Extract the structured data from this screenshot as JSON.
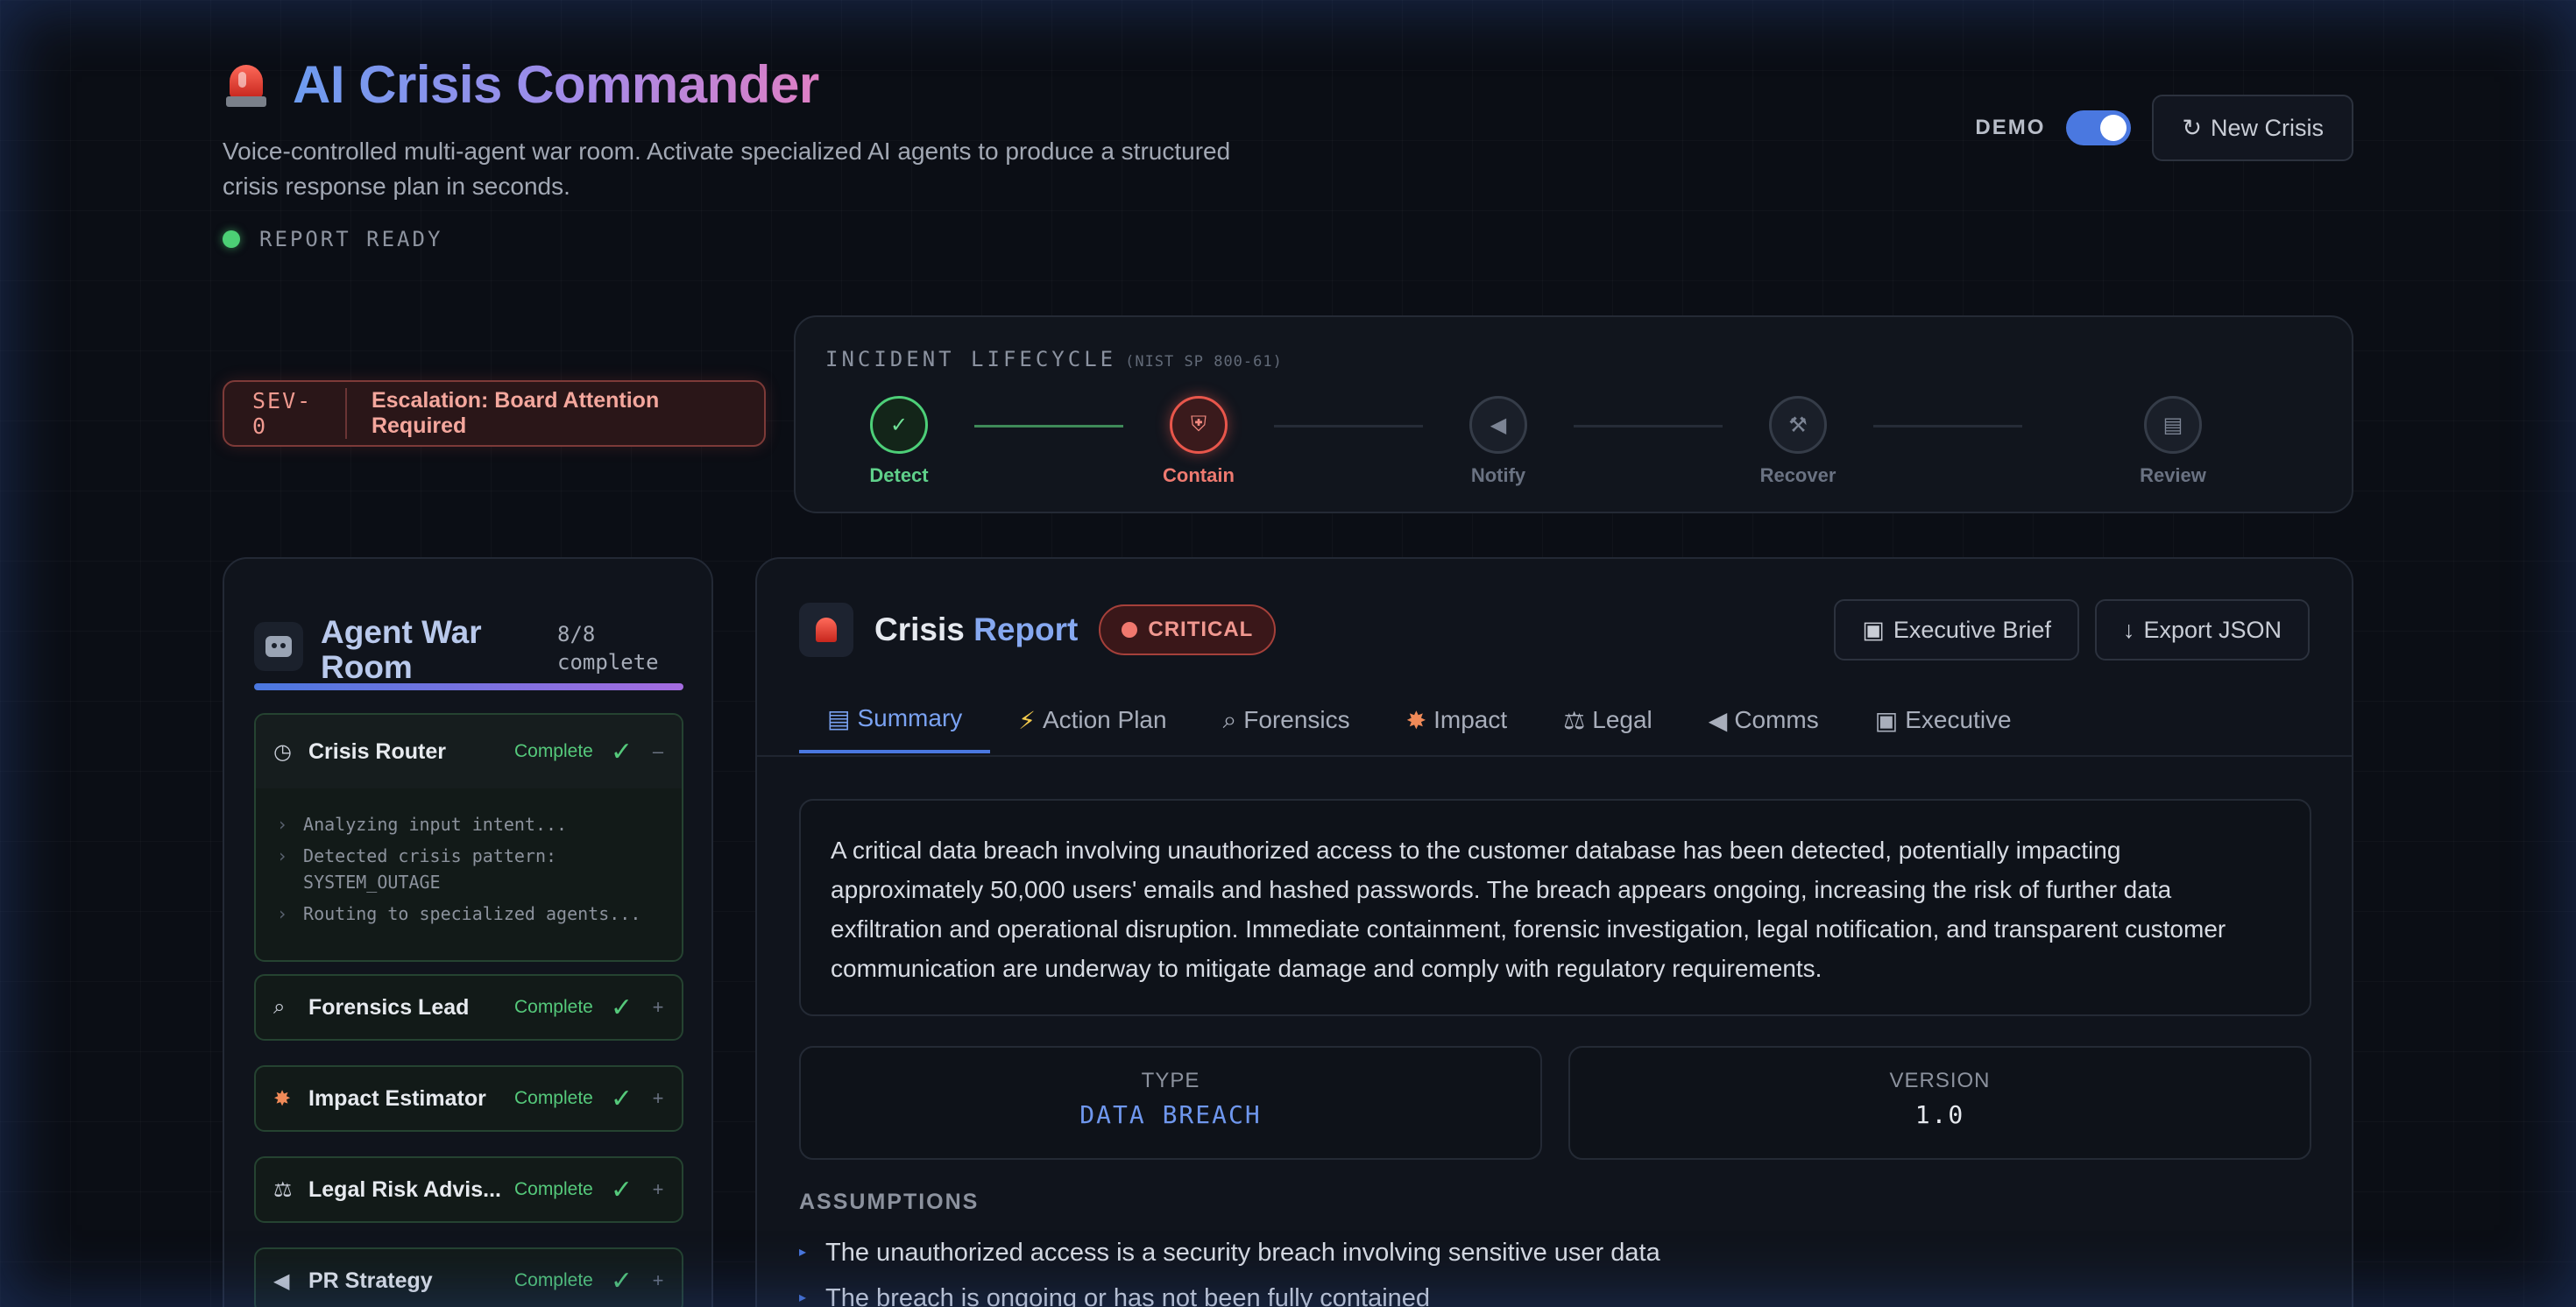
{
  "header": {
    "title": "AI Crisis Commander",
    "subtitle": "Voice-controlled multi-agent war room. Activate specialized AI agents to produce a structured crisis response plan in seconds.",
    "status": "REPORT READY",
    "demo_label": "DEMO",
    "demo_enabled": true,
    "new_crisis_label": "New Crisis"
  },
  "severity": {
    "code": "SEV-0",
    "text": "Escalation: Board Attention Required"
  },
  "lifecycle": {
    "title": "INCIDENT LIFECYCLE",
    "subtitle": "(NIST SP 800-61)",
    "steps": [
      {
        "label": "Detect",
        "icon": "check-icon",
        "state": "done"
      },
      {
        "label": "Contain",
        "icon": "shield-icon",
        "state": "active"
      },
      {
        "label": "Notify",
        "icon": "megaphone-icon",
        "state": "pending"
      },
      {
        "label": "Recover",
        "icon": "wrench-icon",
        "state": "pending"
      },
      {
        "label": "Review",
        "icon": "clipboard-icon",
        "state": "pending"
      }
    ]
  },
  "agents": {
    "title": "Agent War Room",
    "count": "8/8 complete",
    "progress": 1.0,
    "items": [
      {
        "name": "Crisis Router",
        "icon": "compass-icon",
        "status": "Complete",
        "toggle": "–",
        "expanded": true,
        "logs": [
          "Analyzing input intent...",
          "Detected crisis pattern: SYSTEM_OUTAGE",
          "Routing to specialized agents..."
        ]
      },
      {
        "name": "Forensics Lead",
        "icon": "magnifier-icon",
        "status": "Complete",
        "toggle": "+"
      },
      {
        "name": "Impact Estimator",
        "icon": "explosion-icon",
        "status": "Complete",
        "toggle": "+"
      },
      {
        "name": "Legal Risk Advis...",
        "icon": "scales-icon",
        "status": "Complete",
        "toggle": "+"
      },
      {
        "name": "PR Strategy",
        "icon": "megaphone-icon",
        "status": "Complete",
        "toggle": "+"
      }
    ]
  },
  "report": {
    "title_main": "Crisis",
    "title_accent": "Report",
    "severity_badge": "CRITICAL",
    "executive_brief_label": "Executive Brief",
    "export_label": "Export JSON",
    "tabs": [
      {
        "label": "Summary",
        "icon": "clipboard-icon",
        "active": true
      },
      {
        "label": "Action Plan",
        "icon": "lightning-icon"
      },
      {
        "label": "Forensics",
        "icon": "magnifier-icon"
      },
      {
        "label": "Impact",
        "icon": "explosion-icon"
      },
      {
        "label": "Legal",
        "icon": "scales-icon"
      },
      {
        "label": "Comms",
        "icon": "megaphone-icon"
      },
      {
        "label": "Executive",
        "icon": "executive-icon"
      }
    ],
    "summary": "A critical data breach involving unauthorized access to the customer database has been detected, potentially impacting approximately 50,000 users' emails and hashed passwords. The breach appears ongoing, increasing the risk of further data exfiltration and operational disruption. Immediate containment, forensic investigation, legal notification, and transparent customer communication are underway to mitigate damage and comply with regulatory requirements.",
    "type_label": "TYPE",
    "type_value": "DATA BREACH",
    "version_label": "VERSION",
    "version_value": "1.0",
    "assumptions_title": "ASSUMPTIONS",
    "assumptions": [
      "The unauthorized access is a security breach involving sensitive user data",
      "The breach is ongoing or has not been fully contained"
    ]
  },
  "colors": {
    "accent": "#4a78e0",
    "success": "#4dcf78",
    "danger": "#e8564b",
    "background": "#0b0e15"
  }
}
